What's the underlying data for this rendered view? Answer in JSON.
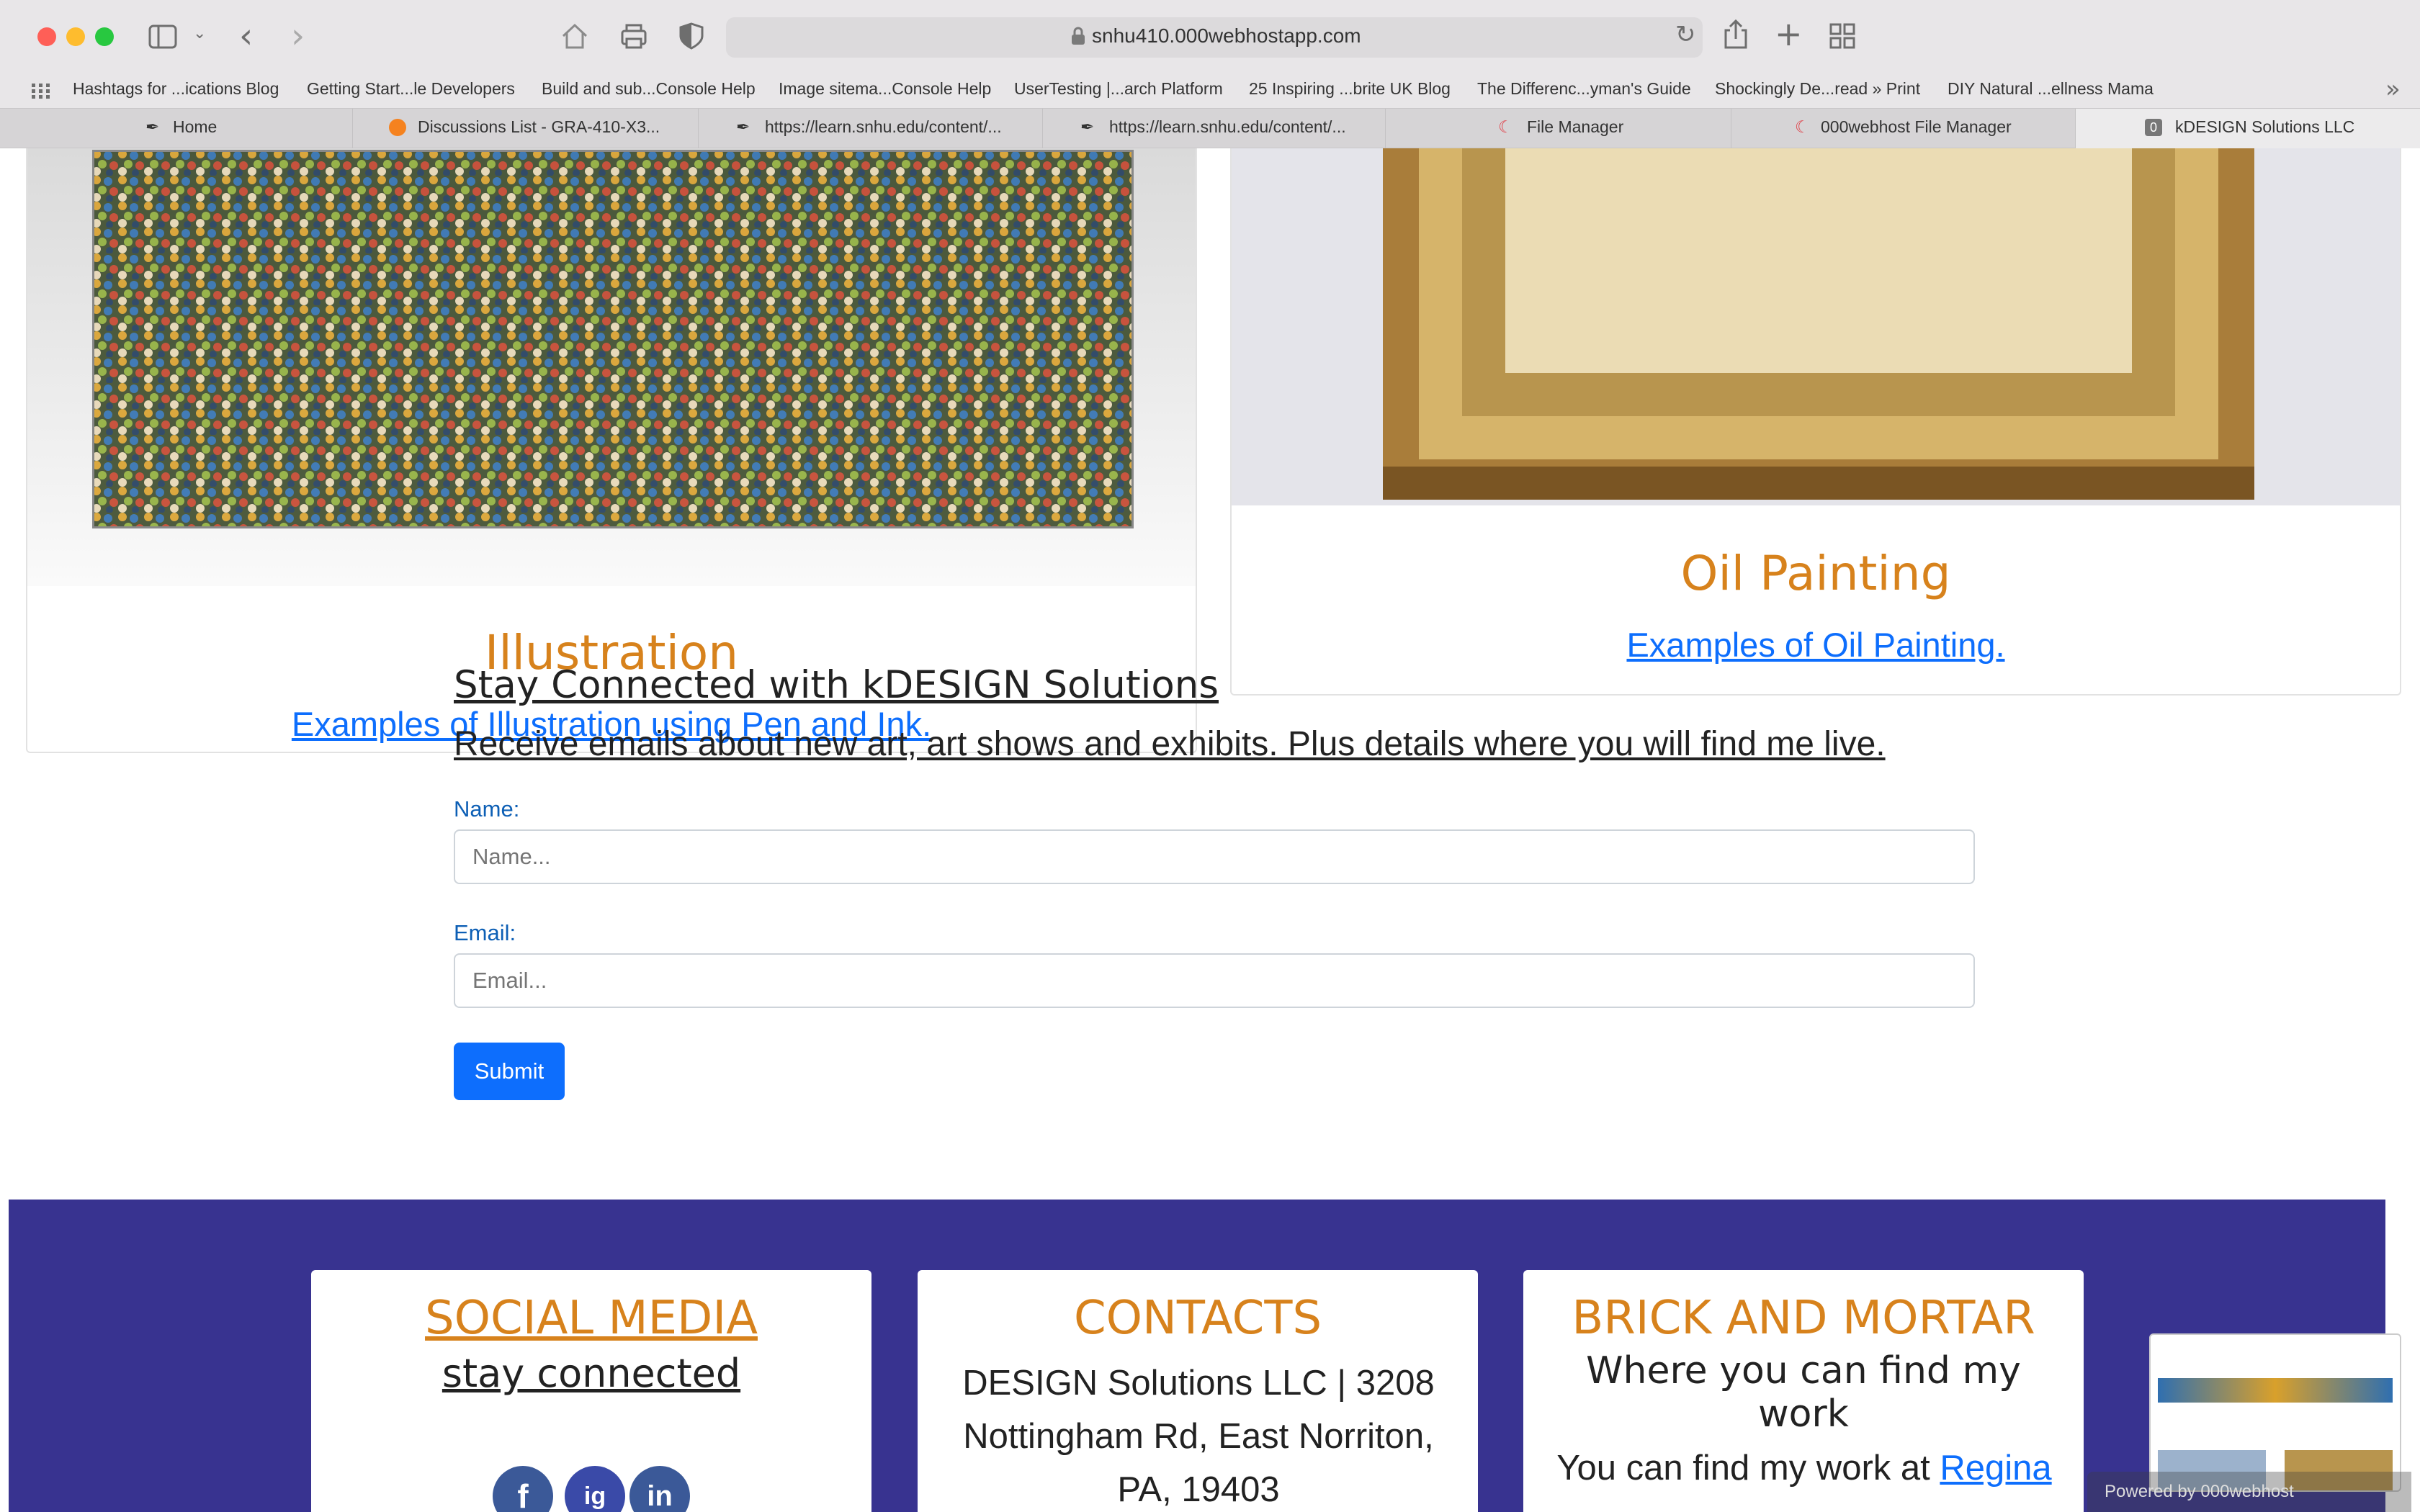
{
  "browser": {
    "url": "snhu410.000webhostapp.com",
    "bookmarks": [
      "Hashtags for ...ications Blog",
      "Getting Start...le Developers",
      "Build and sub...Console Help",
      "Image sitema...Console Help",
      "UserTesting |...arch Platform",
      "25 Inspiring ...brite UK Blog",
      "The Differenc...yman's Guide",
      "Shockingly De...read » Print",
      "DIY Natural ...ellness Mama"
    ],
    "tabs": [
      "Home",
      "Discussions List - GRA-410-X3...",
      "https://learn.snhu.edu/content/...",
      "https://learn.snhu.edu/content/...",
      "File Manager",
      "000webhost File Manager",
      "kDESIGN Solutions LLC"
    ]
  },
  "cards": {
    "illustration": {
      "title": "Illustration",
      "link": "Examples of Illustration using Pen and Ink."
    },
    "oil": {
      "title": "Oil Painting",
      "link": "Examples of Oil Painting."
    }
  },
  "signup": {
    "title": "Stay Connected with kDESIGN Solutions",
    "subtitle": "Receive emails about new art, art shows and exhibits. Plus details where you will find me live.",
    "name_label": "Name:",
    "name_placeholder": "Name...",
    "email_label": "Email:",
    "email_placeholder": "Email...",
    "submit_label": "Submit"
  },
  "footer": {
    "social": {
      "title": "SOCIAL MEDIA",
      "subtitle": "stay connected",
      "icons": [
        "f",
        "ig",
        "in"
      ]
    },
    "contacts": {
      "title": "CONTACTS",
      "body": "DESIGN Solutions LLC | 3208 Nottingham Rd, East Norriton, PA, 19403"
    },
    "brick": {
      "title": "BRICK AND MORTAR",
      "subtitle": "Where you can find my work",
      "body_prefix": "You can find my work at",
      "body_link": "Regina"
    }
  },
  "powered_by": "Powered by 000webhost",
  "colors": {
    "accent_orange": "#d7821c",
    "link_blue": "#0d6efd",
    "footer_purple": "#383390"
  }
}
